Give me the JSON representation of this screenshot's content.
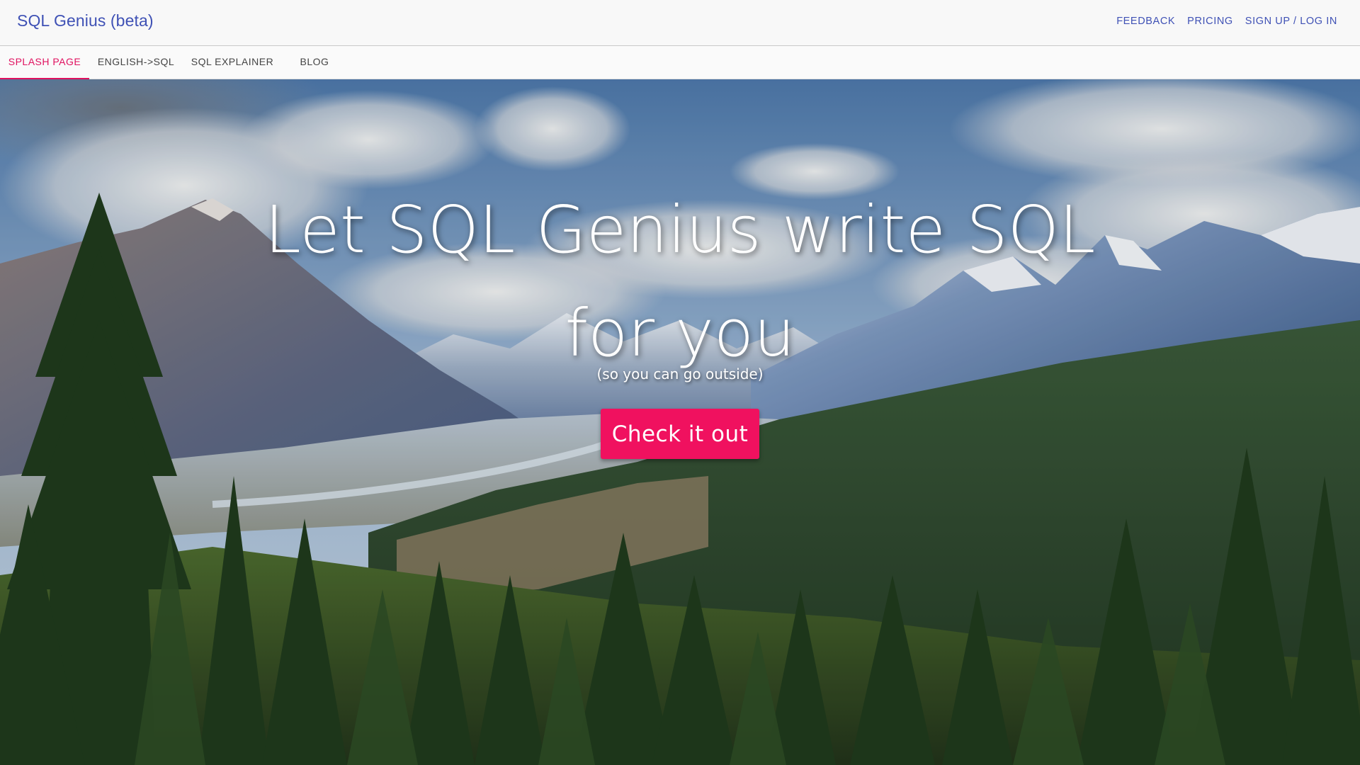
{
  "app": {
    "title": "SQL Genius (beta)"
  },
  "top_actions": [
    {
      "label": "FEEDBACK"
    },
    {
      "label": "PRICING"
    },
    {
      "label": "SIGN UP / LOG IN"
    }
  ],
  "tabs": [
    {
      "label": "SPLASH PAGE",
      "active": true
    },
    {
      "label": "ENGLISH->SQL",
      "active": false
    },
    {
      "label": "SQL EXPLAINER",
      "active": false
    },
    {
      "label": "BLOG",
      "active": false
    }
  ],
  "hero": {
    "headline_line1": "Let SQL Genius write SQL",
    "headline_line2": "for you",
    "subline": "(so you can go outside)",
    "cta_label": "Check it out",
    "background_image": "mountain-forest-landscape"
  },
  "colors": {
    "brand": "#3f51b5",
    "accent": "#e0115f",
    "cta": "#f0115f"
  }
}
